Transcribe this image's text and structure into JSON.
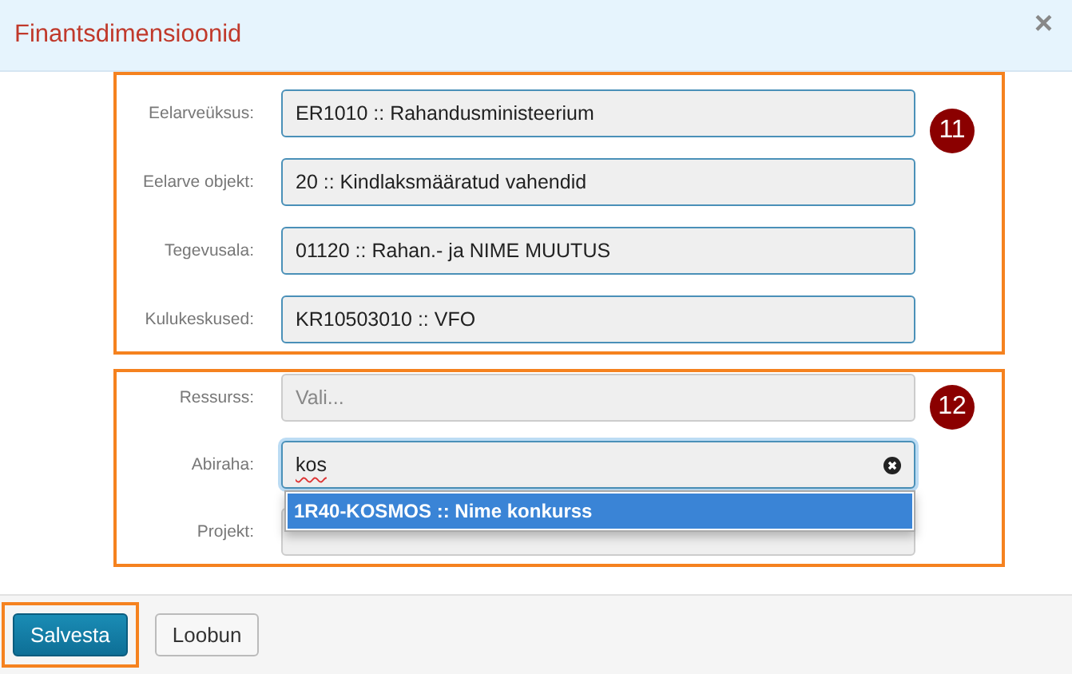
{
  "dialog": {
    "title": "Finantsdimensioonid",
    "close": "×"
  },
  "groups": [
    {
      "badge": "11",
      "fields": [
        {
          "label": "Eelarveüksus:",
          "value": "ER1010 :: Rahandusministeerium",
          "focused": false
        },
        {
          "label": "Eelarve objekt:",
          "value": "20 :: Kindlaksmääratud vahendid",
          "focused": false
        },
        {
          "label": "Tegevusala:",
          "value": "01120 :: Rahan.- ja NIME MUUTUS",
          "focused": false
        },
        {
          "label": "Kulukeskused:",
          "value": "KR10503010 :: VFO",
          "focused": false
        }
      ]
    },
    {
      "badge": "12",
      "fields": [
        {
          "label": "Ressurss:",
          "placeholder": "Vali...",
          "focused": false
        },
        {
          "label": "Abiraha:",
          "value": "kos",
          "focused": true,
          "clearable": true,
          "options": [
            {
              "label": "1R40-KOSMOS :: Nime konkurss",
              "selected": true
            }
          ]
        },
        {
          "label": "Projekt:",
          "focused": false
        }
      ]
    }
  ],
  "buttons": [
    {
      "label": "Salvesta",
      "kind": "primary",
      "highlighted": true
    },
    {
      "label": "Loobun",
      "kind": "default",
      "highlighted": false
    }
  ]
}
